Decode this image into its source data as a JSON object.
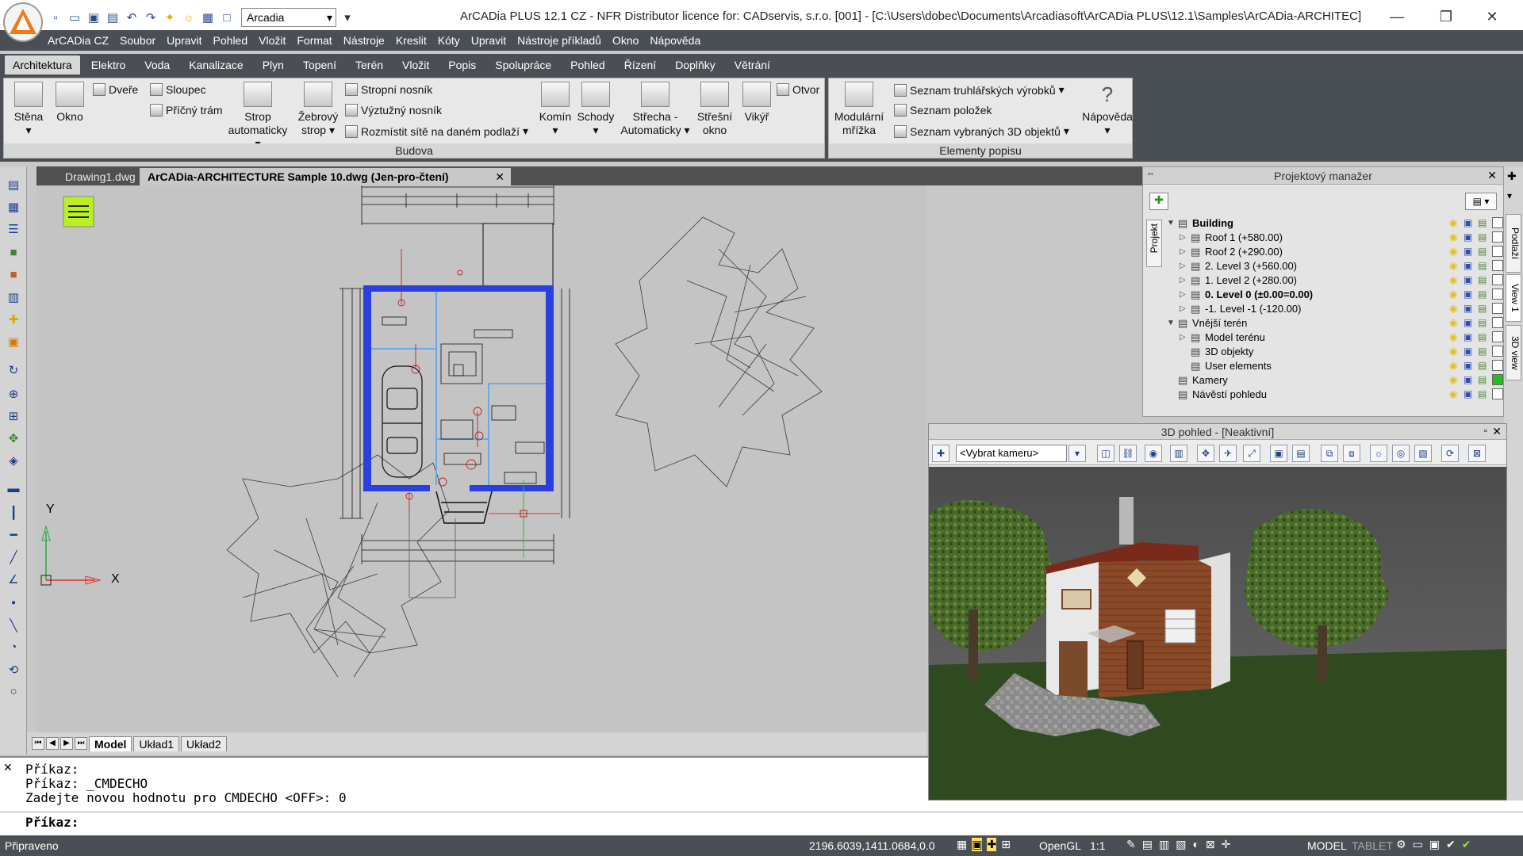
{
  "app": {
    "title": "ArCADia PLUS 12.1 CZ - NFR Distributor licence for: CADservis, s.r.o. [001] - [C:\\Users\\dobec\\Documents\\Arcadiasoft\\ArCADia PLUS\\12.1\\Samples\\ArCADia-ARCHITEC]",
    "layer_value": "Arcadia"
  },
  "menu": [
    "ArCADia CZ",
    "Soubor",
    "Upravit",
    "Pohled",
    "Vložit",
    "Format",
    "Nástroje",
    "Kreslit",
    "Kóty",
    "Upravit",
    "Nástroje příkladů",
    "Okno",
    "Nápověda"
  ],
  "ribbon_tabs": [
    "Architektura",
    "Elektro",
    "Voda",
    "Kanalizace",
    "Plyn",
    "Topení",
    "Terén",
    "Vložit",
    "Popis",
    "Spolupráce",
    "Pohled",
    "Řízení",
    "Doplňky",
    "Větrání"
  ],
  "ribbon": {
    "budova": {
      "title": "Budova",
      "stena": "Stěna",
      "okno": "Okno",
      "dvere": "Dveře",
      "sloupec": "Sloupec",
      "pricny_tram": "Příčný trám",
      "strop_1": "Strop",
      "strop_2": "automaticky",
      "zebrovy_1": "Žebrový",
      "zebrovy_2": "strop",
      "stropni_nosnik": "Stropní nosník",
      "vyztuzny_nosnik": "Výztužný nosník",
      "rozmistit": "Rozmístit sítě na daném podlaží",
      "komin": "Komín",
      "schody": "Schody",
      "strecha_1": "Střecha -",
      "strecha_2": "Automaticky",
      "stresni_1": "Střešní",
      "stresni_2": "okno",
      "vikyr": "Vikýř",
      "otvor": "Otvor"
    },
    "popis": {
      "title": "Elementy popisu",
      "mrizka_1": "Modulární",
      "mrizka_2": "mřížka",
      "seznam_truhlar": "Seznam truhlářských výrobků",
      "seznam_polozek": "Seznam položek",
      "seznam_3d": "Seznam vybraných 3D objektů",
      "napoveda": "Nápověda"
    }
  },
  "doc_tabs": [
    "Drawing1.dwg",
    "ArCADia-ARCHITECTURE Sample 10.dwg (Jen-pro-čtení)"
  ],
  "layout_tabs": [
    "Model",
    "Układ1",
    "Układ2"
  ],
  "axes": {
    "x": "X",
    "y": "Y"
  },
  "command": {
    "lines": [
      "Příkaz:",
      "Příkaz: _CMDECHO",
      "Zadejte novou hodnotu pro CMDECHO <OFF>: 0"
    ],
    "prompt": "Příkaz:"
  },
  "status": {
    "ready": "Připraveno",
    "coords": "2196.6039,1411.0684,0.0",
    "renderer": "OpenGL",
    "scale": "1:1",
    "model": "MODEL",
    "tablet": "TABLET"
  },
  "project_manager": {
    "title": "Projektový manažer",
    "side_tab": "Projekt",
    "tree": [
      {
        "label": "Building",
        "level": 0,
        "bold": true,
        "expand": "open"
      },
      {
        "label": "Roof 1 (+580.00)",
        "level": 1,
        "expand": "closed"
      },
      {
        "label": "Roof 2 (+290.00)",
        "level": 1,
        "expand": "closed"
      },
      {
        "label": "2. Level 3 (+560.00)",
        "level": 1,
        "expand": "closed"
      },
      {
        "label": "1. Level 2 (+280.00)",
        "level": 1,
        "expand": "closed"
      },
      {
        "label": "0. Level 0 (±0.00=0.00)",
        "level": 1,
        "bold": true,
        "expand": "closed"
      },
      {
        "label": "-1. Level -1 (-120.00)",
        "level": 1,
        "expand": "closed"
      },
      {
        "label": "Vnější terén",
        "level": 0,
        "expand": "open"
      },
      {
        "label": "Model terénu",
        "level": 1,
        "expand": "closed"
      },
      {
        "label": "3D objekty",
        "level": 1,
        "expand": "none"
      },
      {
        "label": "User elements",
        "level": 1,
        "expand": "none"
      },
      {
        "label": "Kamery",
        "level": 0,
        "expand": "none"
      },
      {
        "label": "Návěstí pohledu",
        "level": 0,
        "expand": "none"
      }
    ]
  },
  "right_tabs": [
    "Podlaží",
    "View 1",
    "3D view"
  ],
  "view3d": {
    "title": "3D pohled - [Neaktivní]",
    "camera": "<Vybrat kameru>"
  },
  "colors": {
    "chrome": "#4a4f55",
    "wall_blue": "#2b3fe0",
    "grass": "#2e4a1e",
    "wood": "#8a4a2a"
  }
}
